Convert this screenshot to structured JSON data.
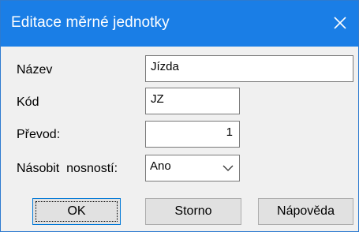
{
  "window": {
    "title": "Editace měrné jednotky",
    "close_glyph": "close-icon"
  },
  "form": {
    "name_label": "Název",
    "name_value": "Jízda",
    "code_label": "Kód",
    "code_value": "JZ",
    "conversion_label": "Převod:",
    "conversion_value": "1",
    "multiply_label": "Násobit  nosností:",
    "multiply_value": "Ano"
  },
  "buttons": {
    "ok_label": "OK",
    "cancel_label": "Storno",
    "help_label": "Nápověda"
  },
  "colors": {
    "titlebar": "#1a7ee6",
    "window_bg": "#f0f0f0",
    "focus_border": "#0078d7"
  }
}
